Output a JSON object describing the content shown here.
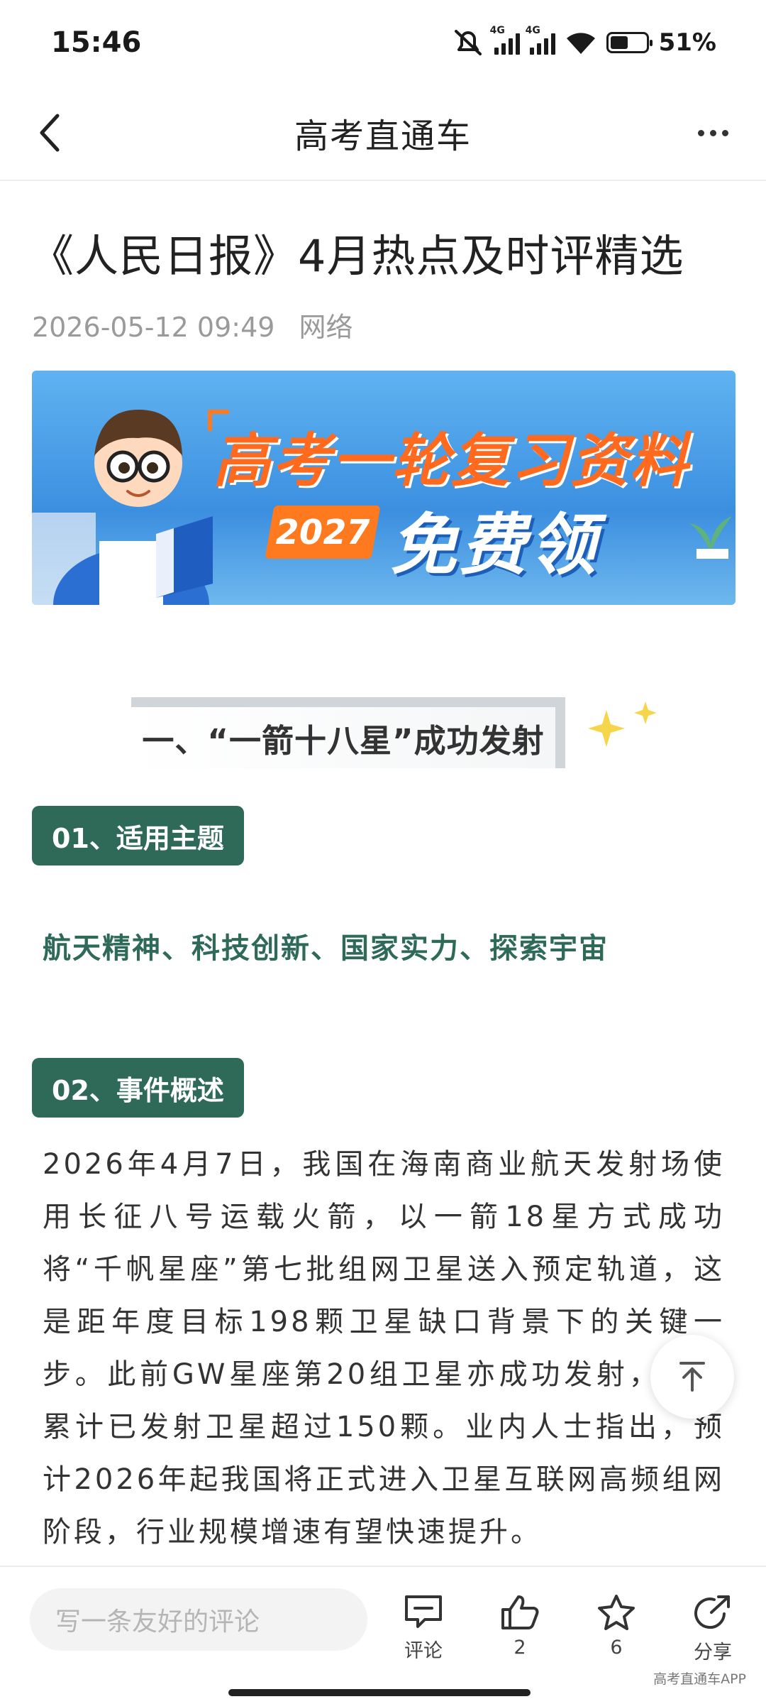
{
  "status_bar": {
    "time": "15:46",
    "signal1_label": "4G",
    "signal2_label": "4G",
    "battery_percent": "51%",
    "battery_level": 0.51
  },
  "nav": {
    "title": "高考直通车"
  },
  "article": {
    "title": "《人民日报》4月热点及时评精选",
    "date": "2026-05-12 09:49",
    "source": "网络",
    "banner": {
      "line1": "高考一轮复习资料",
      "year": "2027",
      "line2": "免费领"
    },
    "section_heading": "一、“一箭十八星”成功发射",
    "pill1": "01、适用主题",
    "topics": "航天精神、科技创新、国家实力、探索宇宙",
    "pill2": "02、事件概述",
    "overview": "2026年4月7日，我国在海南商业航天发射场使用长征八号运载火箭，以一箭18星方式成功将“千帆星座”第七批组网卫星送入预定轨道，这是距年度目标198颗卫星缺口背景下的关键一步。此前GW星座第20组卫星亦成功发射，中国累计已发射卫星超过150颗。业内人士指出，预计2026年起我国将正式进入卫星互联网高频组网阶段，行业规模增速有望快速提升。"
  },
  "bottom_bar": {
    "comment_placeholder": "写一条友好的评论",
    "comment_label": "评论",
    "like_count": "2",
    "favorite_count": "6",
    "share_label": "分享",
    "watermark": "高考直通车APP"
  },
  "colors": {
    "accent_green": "#2f6a58",
    "banner_orange": "#ff6a1f",
    "banner_blue": "#3c8fe0"
  }
}
